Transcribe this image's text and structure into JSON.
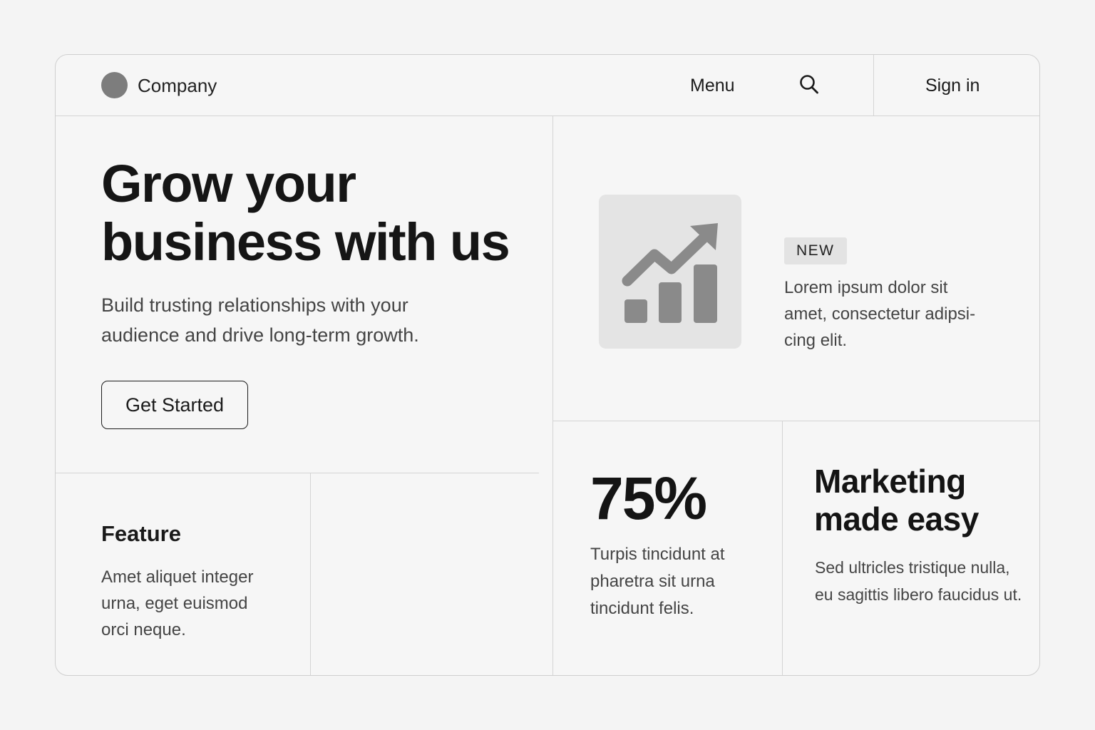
{
  "header": {
    "company": "Company",
    "menu_label": "Menu",
    "search_icon": "search-icon",
    "signin_label": "Sign in"
  },
  "hero": {
    "title_line1": "Grow your",
    "title_line2": "business with us",
    "subtitle_line1": "Build trusting relationships with your",
    "subtitle_line2": "audience and drive long-term growth.",
    "cta_label": "Get Started"
  },
  "feature_panel": {
    "icon": "growth-chart-icon",
    "badge": "NEW",
    "text_line1": "Lorem ipsum dolor sit",
    "text_line2": "amet, consectetur adipsi-",
    "text_line3": "cing elit."
  },
  "feature": {
    "heading": "Feature",
    "text_line1": "Amet aliquet integer",
    "text_line2": "urna, eget euismod",
    "text_line3": "orci neque."
  },
  "stat": {
    "value": "75%",
    "text_line1": "Turpis tincidunt at",
    "text_line2": "pharetra sit urna",
    "text_line3": "tincidunt felis."
  },
  "marketing": {
    "title_line1": "Marketing",
    "title_line2": "made easy",
    "text_line1": "Sed ultricles tristique nulla,",
    "text_line2": "eu sagittis libero faucidus ut."
  },
  "colors": {
    "background": "#f4f4f4",
    "card": "#f6f6f6",
    "border": "#d4d4d4",
    "icon_gray": "#8a8a8a",
    "tile_gray": "#e4e4e4",
    "text_dark": "#151515",
    "text_muted": "#444444"
  }
}
